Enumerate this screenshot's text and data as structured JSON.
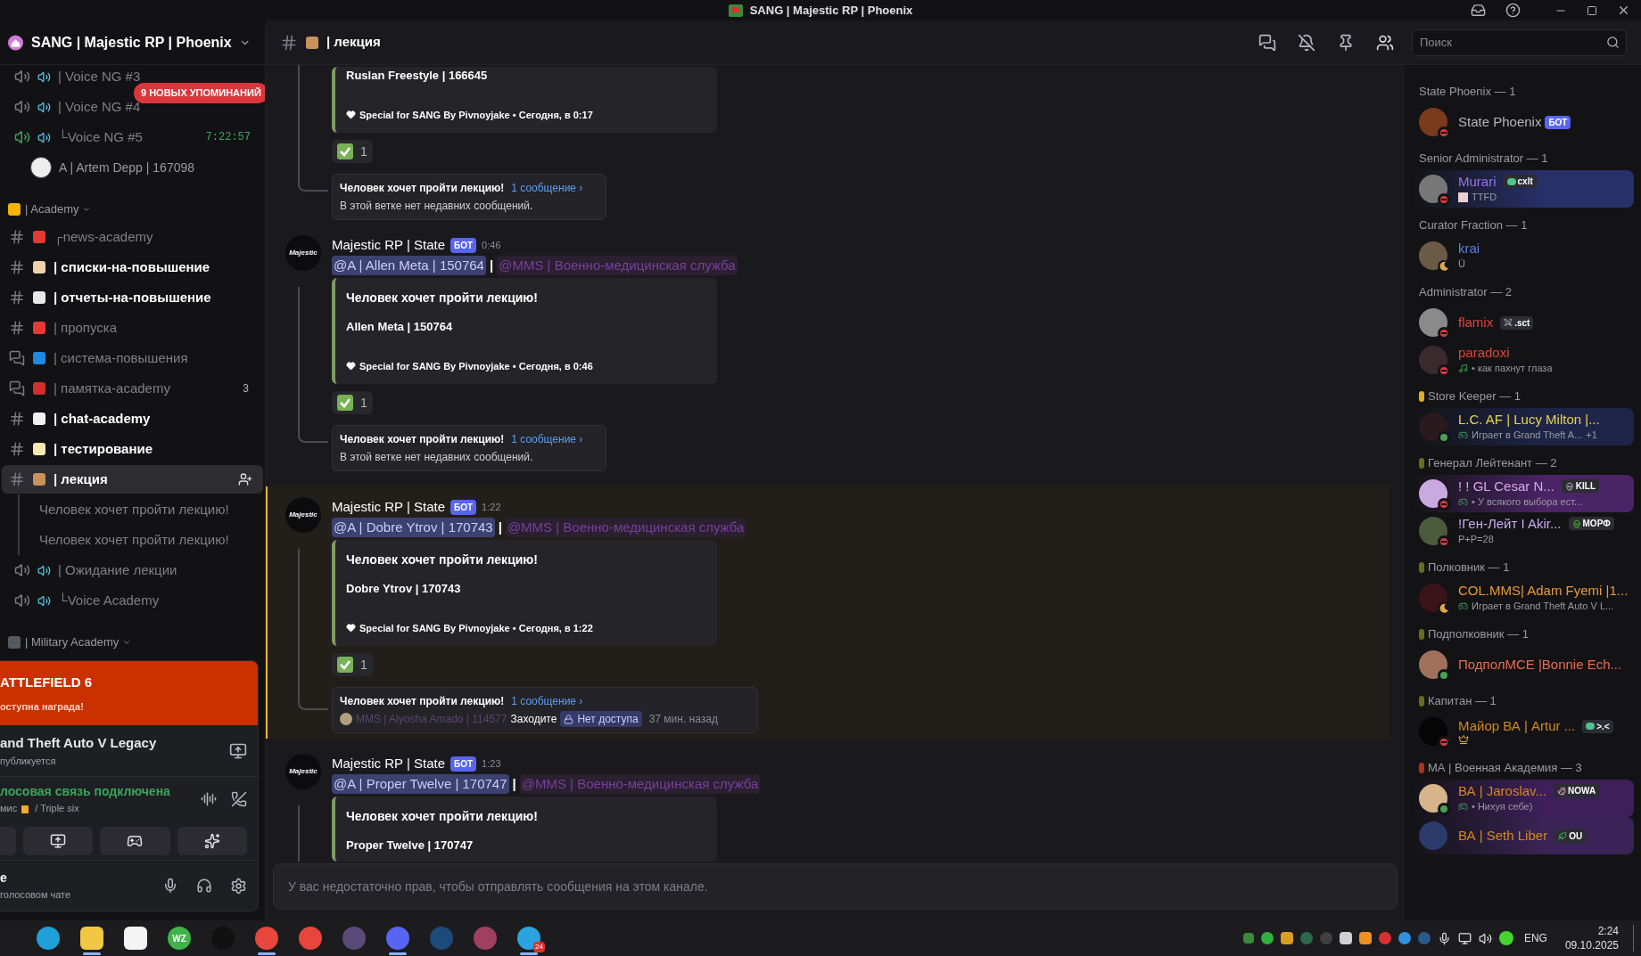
{
  "window": {
    "title": "SANG | Majestic RP | Phoenix"
  },
  "server": {
    "name": "SANG | Majestic RP | Phoenix"
  },
  "mentions_badge": "9 НОВЫХ УПОМИНАНИЙ",
  "sidebar": [
    {
      "kind": "voice",
      "name": "| Voice NG #3",
      "connected": false,
      "selected": false
    },
    {
      "kind": "voice",
      "name": "| Voice NG #4",
      "connected": false,
      "selected": false
    },
    {
      "kind": "voice",
      "name": "└Voice NG #5",
      "connected": true,
      "timer": "7:22:57",
      "selected": false
    },
    {
      "kind": "user",
      "name": "A | Artem Depp | 167098"
    },
    {
      "kind": "category",
      "name": "| Academy"
    },
    {
      "kind": "text",
      "name": "┌news-academy",
      "unread": false,
      "selected": false
    },
    {
      "kind": "text",
      "name": "| списки-на-повышение",
      "unread": true,
      "selected": false
    },
    {
      "kind": "text",
      "name": "| отчеты-на-повышение",
      "unread": true,
      "selected": false
    },
    {
      "kind": "text",
      "name": "| пропуска",
      "unread": false,
      "selected": false
    },
    {
      "kind": "forum",
      "name": "| система-повышения",
      "unread": false,
      "selected": false
    },
    {
      "kind": "forum",
      "name": "| памятка-academy",
      "count": "3",
      "unread": false,
      "selected": false
    },
    {
      "kind": "text",
      "name": "| chat-academy",
      "unread": true,
      "selected": false
    },
    {
      "kind": "text",
      "name": "| тестирование",
      "unread": true,
      "selected": false
    },
    {
      "kind": "text",
      "name": "| лекция",
      "unread": true,
      "selected": true
    },
    {
      "kind": "thread",
      "name": "Человек хочет пройти лекцию!",
      "selected": false
    },
    {
      "kind": "thread",
      "name": "Человек хочет пройти лекцию!",
      "selected": false
    },
    {
      "kind": "voice",
      "name": "| Ожидание лекции",
      "connected": false,
      "selected": false
    },
    {
      "kind": "voice",
      "name": "└Voice Academy",
      "connected": false,
      "selected": false
    },
    {
      "kind": "category",
      "name": "| Military Academy"
    }
  ],
  "panel": {
    "banner_title": "ATTLEFIELD 6",
    "banner_subtitle": "оступна награда!",
    "activity_title": "and Theft Auto V Legacy",
    "activity_subtitle": "публикуется",
    "voice_status": "лосовая связь подключена",
    "voice_channel": "мис",
    "voice_channel_rest": "/ Triple six",
    "user_name": "е",
    "user_status": "голосовом чате"
  },
  "chat": {
    "channel": "| лекция",
    "search": {
      "placeholder": "Поиск"
    },
    "messages": [
      {
        "kind": "partial",
        "highlighted": false,
        "embed": {
          "body": "Ruslan Freestyle | 166645",
          "footer": "Special for SANG By Pivnoyjake • Сегодня, в 0:17"
        },
        "reaction": {
          "count": "1"
        },
        "thread": {
          "title": "Человек хочет пройти лекцию!",
          "link": "1 сообщение ›",
          "text": "В этой ветке нет недавних сообщений."
        }
      },
      {
        "kind": "full",
        "highlighted": false,
        "avatar_text": "Majestic",
        "author": "Majestic RP | State",
        "bot_tag": "БОТ",
        "time": "0:46",
        "mentions": [
          {
            "kind": "user",
            "text": "@A | Allen Meta | 150764"
          },
          {
            "kind": "role",
            "text": "@MMS | Военно-медицинская служба"
          }
        ],
        "separator": "|",
        "embed": {
          "title": "Человек хочет пройти лекцию!",
          "body": "Allen Meta | 150764",
          "footer": "Special for SANG By Pivnoyjake • Сегодня, в 0:46"
        },
        "reaction": {
          "count": "1"
        },
        "thread": {
          "title": "Человек хочет пройти лекцию!",
          "link": "1 сообщение ›",
          "text": "В этой ветке нет недавних сообщений."
        }
      },
      {
        "kind": "full",
        "highlighted": true,
        "avatar_text": "Majestic",
        "author": "Majestic RP | State",
        "bot_tag": "БОТ",
        "time": "1:22",
        "mentions": [
          {
            "kind": "user",
            "text": "@A | Dobre Ytrov | 170743"
          },
          {
            "kind": "role",
            "text": "@MMS | Военно-медицинская служба"
          }
        ],
        "separator": "|",
        "embed": {
          "title": "Человек хочет пройти лекцию!",
          "body": "Dobre Ytrov | 170743",
          "footer": "Special for SANG By Pivnoyjake • Сегодня, в 1:22"
        },
        "reaction": {
          "count": "1"
        },
        "thread": {
          "title": "Человек хочет пройти лекцию!",
          "link": "1 сообщение ›",
          "last": {
            "author": "MMS | Alyosha Amado | 114577",
            "text": "Заходите",
            "tag": "Нет доступа",
            "time": "37 мин. назад"
          }
        }
      },
      {
        "kind": "full",
        "highlighted": false,
        "avatar_text": "Majestic",
        "author": "Majestic RP | State",
        "bot_tag": "БОТ",
        "time": "1:23",
        "mentions": [
          {
            "kind": "user",
            "text": "@A | Proper Twelve | 170747"
          },
          {
            "kind": "role",
            "text": "@MMS | Военно-медицинская служба"
          }
        ],
        "separator": "|",
        "embed": {
          "title": "Человек хочет пройти лекцию!",
          "body": "Proper Twelve | 170747"
        }
      }
    ],
    "input": {
      "placeholder": "У вас недостаточно прав, чтобы отправлять сообщения на этом канале."
    }
  },
  "member_groups": [
    {
      "title": "State Phoenix — 1",
      "members": [
        {
          "name": "State Phoenix",
          "color": "#b5b5bc",
          "status": {
            "kind": "dnd"
          },
          "bot_tag": "БОТ",
          "banner": false
        }
      ]
    },
    {
      "title": "Senior Administrator — 1",
      "members": [
        {
          "name": "Murari",
          "color": "#9b72e8",
          "status": {
            "kind": "dnd"
          },
          "tag": {
            "kind": "frog",
            "text": "cxlt"
          },
          "activity": {
            "kind": "image",
            "text": "TTFD"
          },
          "banner": true
        }
      ]
    },
    {
      "title": "Curator Fraction — 1",
      "members": [
        {
          "name": "krai",
          "color": "#5b7fe0",
          "status": {
            "kind": "idle"
          },
          "activity": {
            "kind": "plain",
            "text": "Ū"
          },
          "banner": false
        }
      ]
    },
    {
      "title": "Administrator — 2",
      "members": [
        {
          "name": "flamix",
          "color": "#e0443a",
          "status": {
            "kind": "dnd"
          },
          "tag": {
            "kind": "sword",
            "text": ".sct"
          },
          "banner": false
        },
        {
          "name": "paradoxi",
          "color": "#e0443a",
          "status": {
            "kind": "dnd"
          },
          "activity": {
            "kind": "music",
            "text": "• как пахнут глаза"
          },
          "banner": false
        }
      ]
    },
    {
      "title": "Store Keeper — 1",
      "members": [
        {
          "name": "L.C. AF | Lucy Milton |...",
          "color": "#e8d44d",
          "status": {
            "kind": "online"
          },
          "activity": {
            "kind": "game",
            "text": "Играет в Grand Theft A...",
            "extra": "+1"
          },
          "banner": true
        }
      ]
    },
    {
      "title": "Генерал Лейтенант — 2",
      "members": [
        {
          "name": "! ! GL Cesar N...",
          "color": "#d7a8e8",
          "status": {
            "kind": "dnd"
          },
          "tag": {
            "kind": "skull",
            "text": "KILL"
          },
          "activity": {
            "kind": "game",
            "text": "• У всякого выбора ест..."
          },
          "banner": true
        },
        {
          "name": "!Ген-Лейт I Akir...",
          "color": "#c7a9f0",
          "status": {
            "kind": "dnd"
          },
          "tag": {
            "kind": "green-skull",
            "text": "МОРФ"
          },
          "activity": {
            "kind": "plain",
            "text": "P+P=28"
          },
          "banner": false
        }
      ]
    },
    {
      "title": "Полковник — 1",
      "members": [
        {
          "name": "COL.MMS| Adam Fyemi |1...",
          "color": "#e69a3c",
          "status": {
            "kind": "idle"
          },
          "activity": {
            "kind": "game",
            "text": "Играет в Grand Theft Auto V L..."
          },
          "banner": false
        }
      ]
    },
    {
      "title": "Подполковник — 1",
      "members": [
        {
          "name": "ПодполМСЕ |Bonnie Ech...",
          "color": "#ee6b4d",
          "status": {
            "kind": "online"
          },
          "banner": false
        }
      ]
    },
    {
      "title": "Капитан — 1",
      "members": [
        {
          "name": "Майор ВА | Artur ...",
          "color": "#d4891c",
          "status": {
            "kind": "dnd"
          },
          "tag": {
            "kind": "frog",
            "text": ">.<"
          },
          "activity": {
            "kind": "crown"
          },
          "banner": false
        }
      ]
    },
    {
      "title": "МА | Военная Академия — 3",
      "members": [
        {
          "name": "ВА | Jaroslav...",
          "color": "#d4891c",
          "status": {
            "kind": "online"
          },
          "tag": {
            "kind": "bunny",
            "text": "NOWA"
          },
          "activity": {
            "kind": "game",
            "text": "• Нихуя себе)"
          },
          "banner": true
        },
        {
          "name": "ВА | Seth Liber",
          "color": "#d4891c",
          "status": {
            "kind": "none"
          },
          "tag": {
            "kind": "leaf",
            "text": "OU"
          },
          "banner": true
        }
      ]
    }
  ],
  "taskbar": {
    "apps": [
      {
        "kind": "edge",
        "active": false
      },
      {
        "kind": "folder",
        "active": true
      },
      {
        "kind": "store",
        "active": false
      },
      {
        "kind": "wz",
        "label": "WZ",
        "active": false
      },
      {
        "kind": "spark",
        "active": false
      },
      {
        "kind": "chrome",
        "active": true
      },
      {
        "kind": "chrome",
        "active": false
      },
      {
        "kind": "game",
        "active": false
      },
      {
        "kind": "discord",
        "active": true
      },
      {
        "kind": "steam",
        "active": false
      },
      {
        "kind": "figure",
        "active": false
      },
      {
        "kind": "telegram",
        "badge": "24",
        "active": true
      }
    ],
    "language": "ENG",
    "time": "2:24",
    "date": "09.10.2025"
  }
}
